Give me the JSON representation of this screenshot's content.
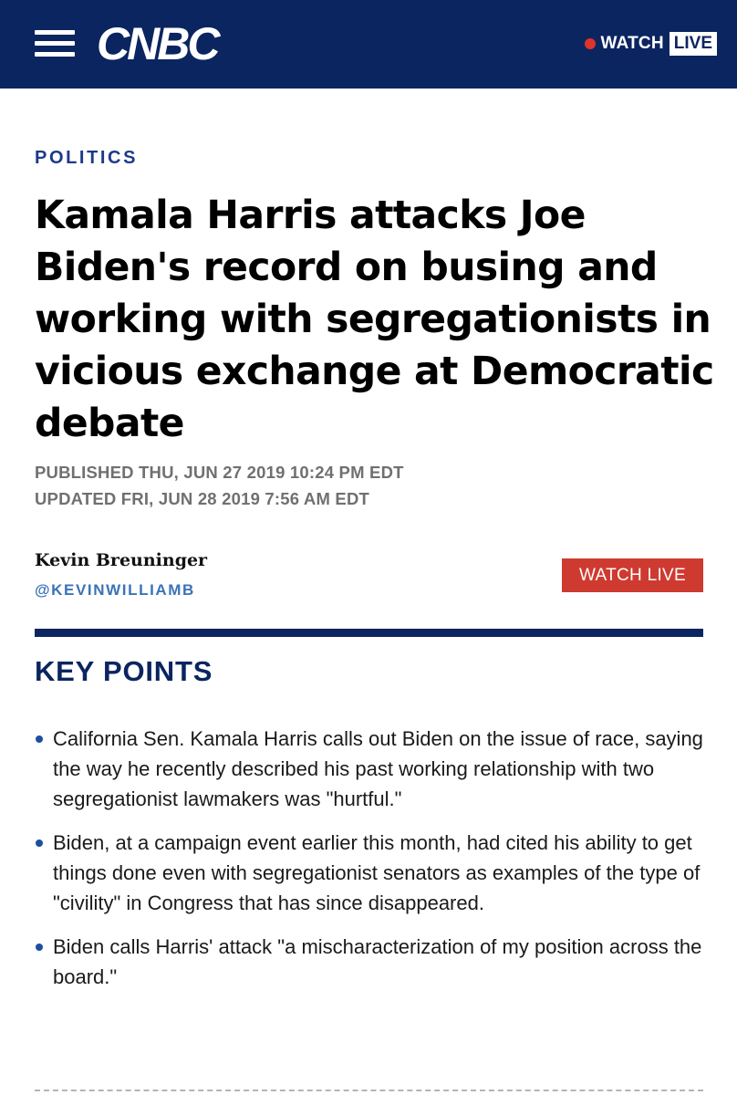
{
  "header": {
    "logo_text": "CNBC",
    "watch_label": "WATCH",
    "live_label": "LIVE",
    "brand_color": "#0b2560",
    "live_dot_color": "#e0332b"
  },
  "article": {
    "section": "POLITICS",
    "headline": "Kamala Harris attacks Joe Biden's record on busing and working with segregationists in vicious exchange at Democratic debate",
    "published": "PUBLISHED THU, JUN 27 2019 10:24 PM EDT",
    "updated": "UPDATED FRI, JUN 28 2019 7:56 AM EDT",
    "author_name": "Kevin Breuninger",
    "author_handle": "@KEVINWILLIAMB",
    "watch_live_button": "WATCH LIVE"
  },
  "key_points": {
    "title": "KEY POINTS",
    "items": [
      "California Sen. Kamala Harris calls out Biden on the issue of race, saying the way he recently described his past working relationship with two segregationist lawmakers was \"hurtful.\"",
      "Biden, at a campaign event earlier this month, had cited his ability to get things done even with segregationist senators as examples of the type of \"civility\" in Congress that has since disappeared.",
      "Biden calls Harris' attack \"a mischaracterization of my position across the board.\""
    ]
  },
  "icons": {
    "menu": "hamburger-menu-icon",
    "live": "live-dot-icon",
    "bullet": "bullet-icon"
  }
}
